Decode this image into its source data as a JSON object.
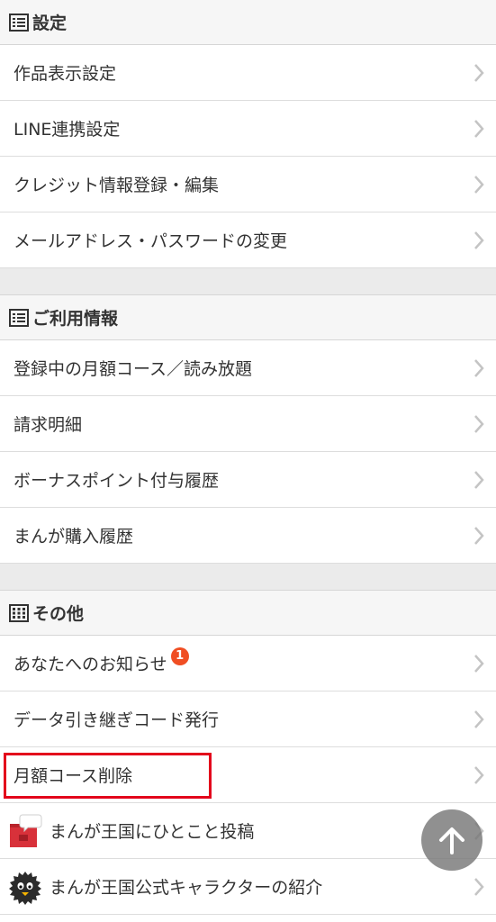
{
  "sections": [
    {
      "title": "設定",
      "icon": "list-icon",
      "items": [
        {
          "label": "作品表示設定"
        },
        {
          "label": "LINE連携設定"
        },
        {
          "label": "クレジット情報登録・編集"
        },
        {
          "label": "メールアドレス・パスワードの変更"
        }
      ]
    },
    {
      "title": "ご利用情報",
      "icon": "list-icon",
      "items": [
        {
          "label": "登録中の月額コース／読み放題"
        },
        {
          "label": "請求明細"
        },
        {
          "label": "ボーナスポイント付与履歴"
        },
        {
          "label": "まんが購入履歴"
        }
      ]
    },
    {
      "title": "その他",
      "icon": "grid-icon",
      "items": [
        {
          "label": "あなたへのお知らせ",
          "badge": "1"
        },
        {
          "label": "データ引き継ぎコード発行"
        },
        {
          "label": "月額コース削除"
        },
        {
          "label": "まんが王国にひとこと投稿",
          "icon": "mailbox-icon"
        },
        {
          "label": "まんが王国公式キャラクターの紹介",
          "icon": "character-icon"
        }
      ]
    }
  ],
  "colors": {
    "highlight": "#e3001b",
    "badge": "#f04e23",
    "scroll_button": "#787878"
  },
  "scroll_top_icon": "arrow-up-icon"
}
